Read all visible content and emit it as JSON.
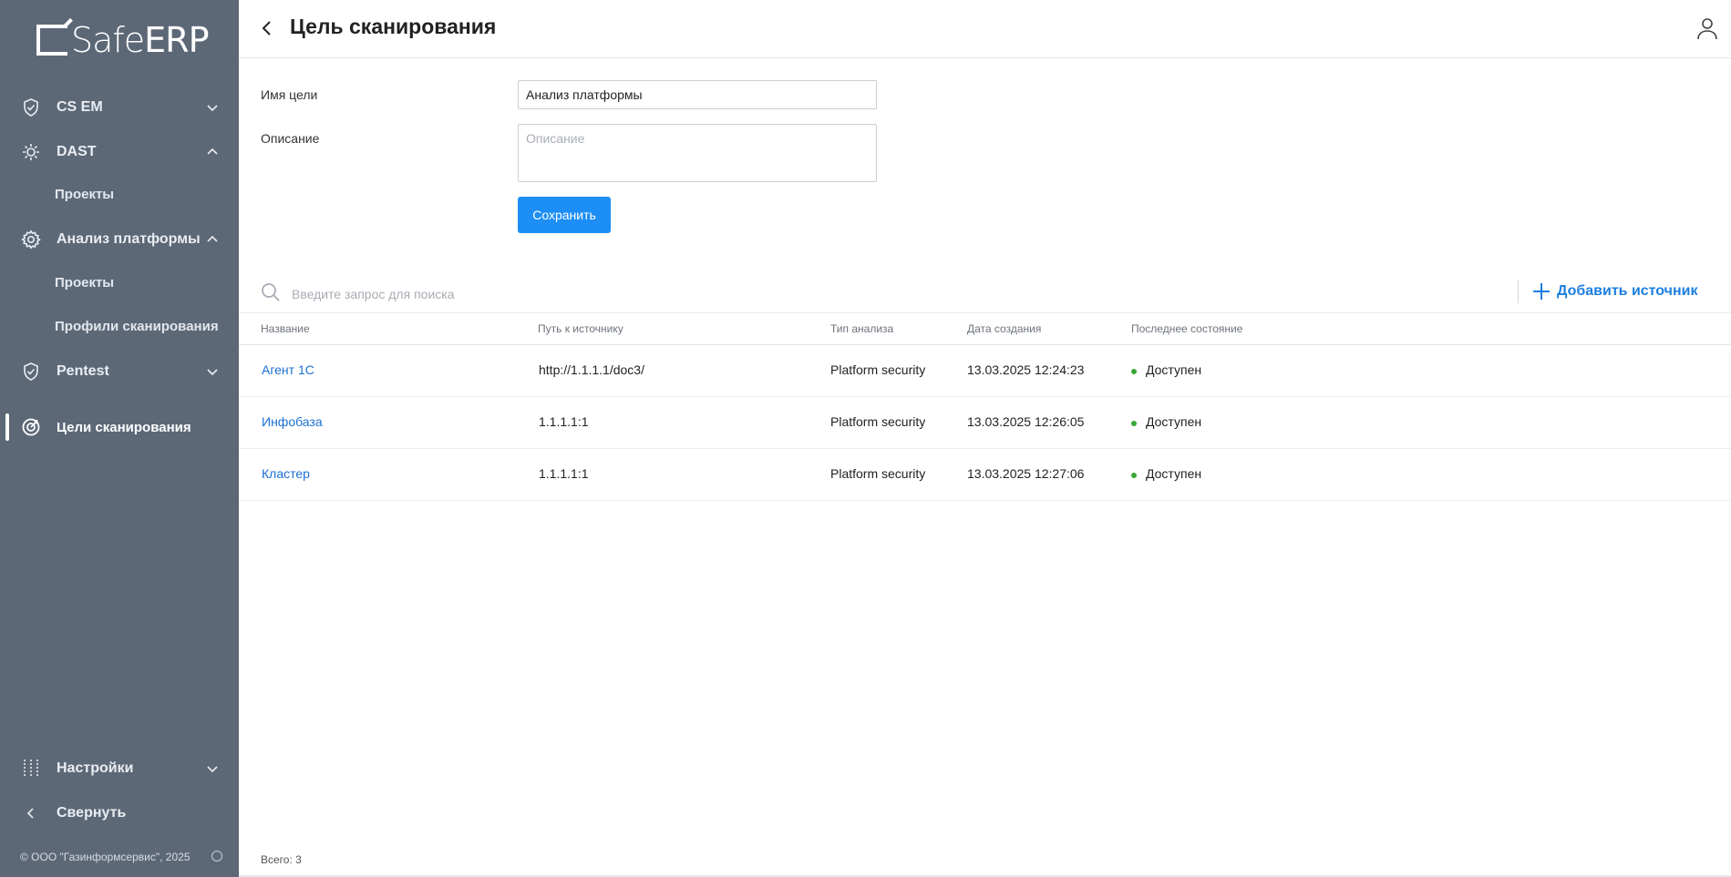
{
  "brand": {
    "logo_text_a": "Safe",
    "logo_text_b": "ERP"
  },
  "sidebar": {
    "items": [
      {
        "label": "CS EM"
      },
      {
        "label": "DAST",
        "sub": [
          "Проекты"
        ]
      },
      {
        "label": "Анализ платформы",
        "sub": [
          "Проекты",
          "Профили сканирования"
        ]
      },
      {
        "label": "Pentest"
      },
      {
        "label": "Цели сканирования"
      }
    ],
    "settings_label": "Настройки",
    "collapse_label": "Свернуть",
    "copyright": "© ООО \"Газинформсервис\", 2025"
  },
  "header": {
    "title": "Цель сканирования"
  },
  "form": {
    "name_label": "Имя цели",
    "name_value": "Анализ платформы",
    "description_label": "Описание",
    "description_placeholder": "Описание",
    "save_label": "Сохранить"
  },
  "search": {
    "placeholder": "Введите запрос для поиска"
  },
  "add_source_label": "Добавить источник",
  "table": {
    "columns": [
      "Название",
      "Путь к источнику",
      "Тип анализа",
      "Дата создания",
      "Последнее состояние"
    ],
    "rows": [
      {
        "name": "Агент 1С",
        "path": "http://1.1.1.1/doc3/",
        "type": "Platform security",
        "created": "13.03.2025 12:24:23",
        "status": "Доступен"
      },
      {
        "name": "Инфобаза",
        "path": "1.1.1.1:1",
        "type": "Platform security",
        "created": "13.03.2025 12:26:05",
        "status": "Доступен"
      },
      {
        "name": "Кластер",
        "path": "1.1.1.1:1",
        "type": "Platform security",
        "created": "13.03.2025 12:27:06",
        "status": "Доступен"
      }
    ]
  },
  "footer": {
    "total": "Всего: 3"
  },
  "colors": {
    "sidebar_bg": "#5d6877",
    "accent": "#1c8ef5",
    "link": "#1c6fd1",
    "status_ok": "#3aa537"
  }
}
